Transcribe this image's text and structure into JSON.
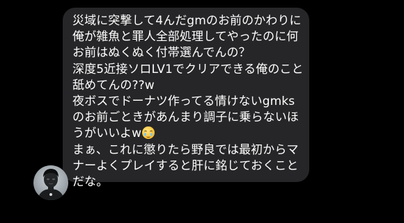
{
  "message": {
    "lines": [
      "災域に突撃して4んだgmのお前のかわりに",
      "俺が雑魚と罪人全部処理してやったのに何",
      "お前はぬくぬく付帯選んでんの？",
      "深度5近接ソロLV1でクリアできる俺のこと",
      "舐めてんの??w",
      "夜ボスでドーナツ作ってる情けないgmks",
      "のお前ごときがあんまり調子に乗らないほ",
      "うがいいよw",
      "まぁ、これに懲りたら野良では最初からマ",
      "ナーよくプレイすると肝に銘じておくこと",
      "だな。"
    ],
    "emoji": "pleading-face-icon"
  },
  "colors": {
    "background": "#000000",
    "bubble": "#262628",
    "text": "#ffffff"
  },
  "avatar": {
    "icon": "user-avatar-icon"
  }
}
